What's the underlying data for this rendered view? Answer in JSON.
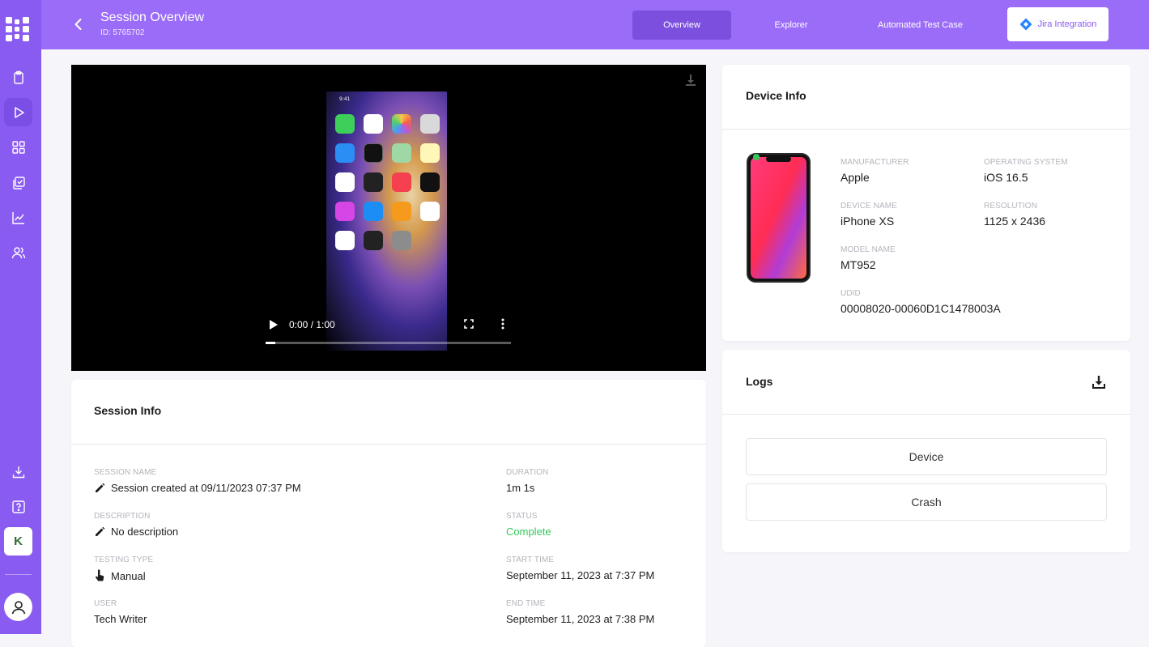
{
  "header": {
    "title": "Session Overview",
    "session_id": "ID: 5765702",
    "tabs": [
      {
        "label": "Overview",
        "active": true
      },
      {
        "label": "Explorer",
        "active": false
      },
      {
        "label": "Automated Test Case",
        "active": false
      }
    ],
    "jira_label": "Jira Integration"
  },
  "video": {
    "time": "0:00 / 1:00",
    "progress": 0.04,
    "status_time": "9:41"
  },
  "session_info": {
    "title": "Session Info",
    "fields": {
      "session_name_label": "SESSION NAME",
      "session_name": "Session created at 09/11/2023 07:37 PM",
      "description_label": "DESCRIPTION",
      "description": "No description",
      "testing_type_label": "TESTING TYPE",
      "testing_type": "Manual",
      "user_label": "USER",
      "user": "Tech Writer",
      "duration_label": "DURATION",
      "duration": "1m 1s",
      "status_label": "STATUS",
      "status": "Complete",
      "start_time_label": "START TIME",
      "start_time": "September 11, 2023 at 7:37 PM",
      "end_time_label": "END TIME",
      "end_time": "September 11, 2023 at 7:38 PM"
    }
  },
  "device_info": {
    "title": "Device Info",
    "manufacturer_label": "MANUFACTURER",
    "manufacturer": "Apple",
    "os_label": "OPERATING SYSTEM",
    "os": "iOS 16.5",
    "device_name_label": "DEVICE NAME",
    "device_name": "iPhone XS",
    "resolution_label": "RESOLUTION",
    "resolution": "1125 x 2436",
    "model_name_label": "MODEL NAME",
    "model_name": "MT952",
    "udid_label": "UDID",
    "udid": "00008020-00060D1C1478003A"
  },
  "logs": {
    "title": "Logs",
    "buttons": [
      "Device",
      "Crash"
    ]
  },
  "sidebar": {
    "workspace_initial": "K"
  },
  "colors": {
    "accent": "#8a5bf0",
    "header": "#9b6cf7",
    "status_complete": "#34c85a"
  }
}
